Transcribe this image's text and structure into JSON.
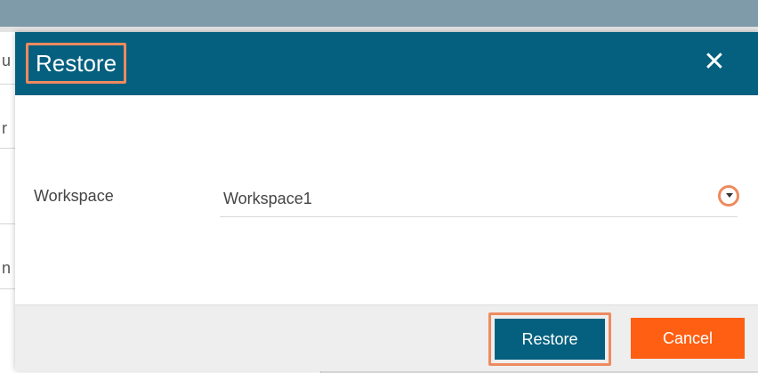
{
  "dialog": {
    "title": "Restore",
    "close_icon": "close-icon"
  },
  "form": {
    "workspace_label": "Workspace",
    "workspace_value": "Workspace1",
    "dropdown_icon": "chevron-down-icon"
  },
  "footer": {
    "restore_label": "Restore",
    "cancel_label": "Cancel"
  },
  "background": {
    "row_fragments": [
      "u",
      "r",
      "n"
    ]
  },
  "colors": {
    "header_bg": "#05607f",
    "primary_button": "#05607f",
    "cancel_button": "#fe5f12",
    "highlight_outline": "#ee8a5e",
    "footer_bg": "#eeeeee"
  }
}
